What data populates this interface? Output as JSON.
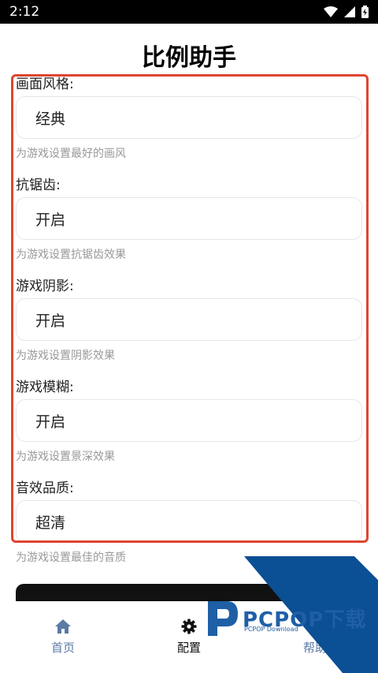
{
  "status_bar": {
    "time": "2:12"
  },
  "app": {
    "title": "比例助手"
  },
  "settings": [
    {
      "label": "画面风格:",
      "value": "经典",
      "hint": "为游戏设置最好的画风"
    },
    {
      "label": "抗锯齿:",
      "value": "开启",
      "hint": "为游戏设置抗锯齿效果"
    },
    {
      "label": "游戏阴影:",
      "value": "开启",
      "hint": "为游戏设置阴影效果"
    },
    {
      "label": "游戏模糊:",
      "value": "开启",
      "hint": "为游戏设置景深效果"
    },
    {
      "label": "音效品质:",
      "value": "超清",
      "hint": "为游戏设置最佳的音质"
    }
  ],
  "nav": [
    {
      "label": "首页",
      "icon": "home-icon",
      "active": false
    },
    {
      "label": "配置",
      "icon": "gear-icon",
      "active": true
    },
    {
      "label": "帮助",
      "icon": "help-icon",
      "active": false
    }
  ],
  "watermark": {
    "brand": "PCPOP下载",
    "sub": "PCPOP Download"
  },
  "colors": {
    "highlight": "#e0452f",
    "nav_inactive": "#5b7aa6",
    "hint": "#999999",
    "watermark": "#0b4f94"
  }
}
